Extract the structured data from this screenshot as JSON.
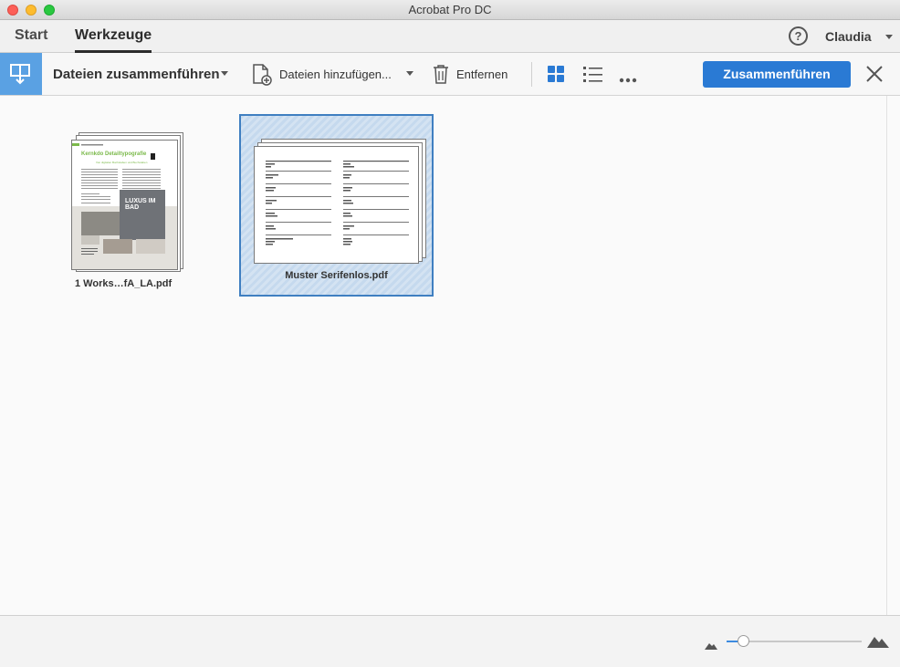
{
  "window": {
    "title": "Acrobat Pro DC"
  },
  "nav": {
    "tabs": [
      {
        "label": "Start"
      },
      {
        "label": "Werkzeuge"
      }
    ],
    "help_label": "?",
    "user_name": "Claudia"
  },
  "toolbar": {
    "tool_name": "Dateien zusammenführen",
    "add_files_label": "Dateien hinzufügen...",
    "remove_label": "Entfernen",
    "merge_button_label": "Zusammenführen"
  },
  "files": [
    {
      "label": "1  Works…fA_LA.pdf",
      "thumbnail": {
        "heading": "Kernkdo Detailtypografie",
        "subheading": "Von digitalen Buchstaben und Buchstaben",
        "image_text": "LUXUS IM BAD"
      }
    },
    {
      "label": "Muster Serifenlos.pdf",
      "selected": true
    }
  ],
  "zoom": {
    "level": 0.12
  },
  "colors": {
    "accent": "#2a7ad4",
    "tool_icon_bg": "#5aa1e3",
    "selection": "#3f7fc1"
  }
}
